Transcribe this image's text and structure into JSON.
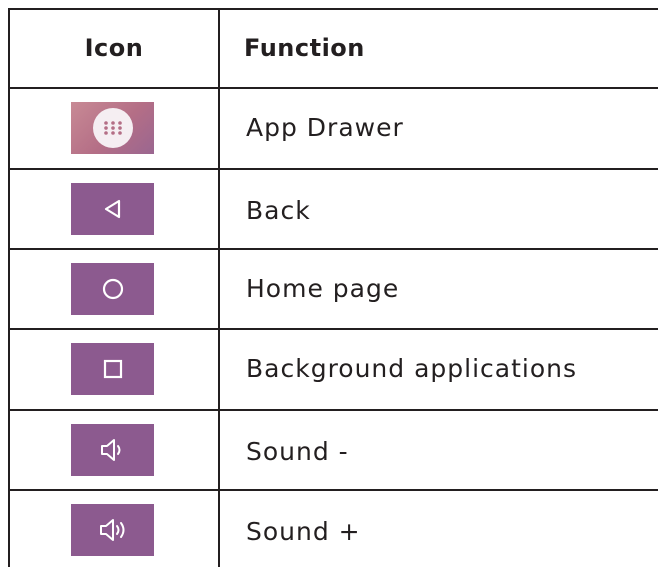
{
  "table": {
    "header": {
      "icon": "Icon",
      "function": "Function"
    },
    "rows": [
      {
        "icon": "app-drawer-icon",
        "label": "App Drawer"
      },
      {
        "icon": "back-icon",
        "label": "Back"
      },
      {
        "icon": "home-icon",
        "label": "Home page"
      },
      {
        "icon": "recent-apps-icon",
        "label": "Background applications"
      },
      {
        "icon": "volume-down-icon",
        "label": "Sound -"
      },
      {
        "icon": "volume-up-icon",
        "label": "Sound +"
      }
    ]
  },
  "colors": {
    "border": "#231f20",
    "icon_background": "#8c5a8f",
    "icon_glyph": "#ffffff",
    "drawer_background": "#b46e86"
  }
}
